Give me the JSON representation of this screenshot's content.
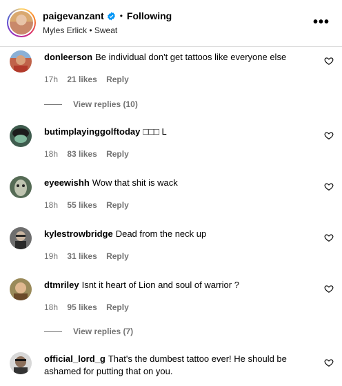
{
  "header": {
    "username": "paigevanzant",
    "separator": "•",
    "following": "Following",
    "audio": "Myles Erlick • Sweat",
    "more": "•••"
  },
  "comments": [
    {
      "user": "donleerson",
      "text": "Be individual don't get tattoos like everyone else",
      "time": "17h",
      "likes": "21 likes",
      "reply": "Reply"
    },
    {
      "user": "butimplayinggolftoday",
      "text": "□□□ L",
      "time": "18h",
      "likes": "83 likes",
      "reply": "Reply"
    },
    {
      "user": "eyeewishh",
      "text": "Wow that shit is wack",
      "time": "18h",
      "likes": "55 likes",
      "reply": "Reply"
    },
    {
      "user": "kylestrowbridge",
      "text": "Dead from the neck up",
      "time": "19h",
      "likes": "31 likes",
      "reply": "Reply"
    },
    {
      "user": "dtmriley",
      "text": "Isnt it heart of Lion and soul of warrior ?",
      "time": "18h",
      "likes": "95 likes",
      "reply": "Reply"
    },
    {
      "user": "official_lord_g",
      "text": "That's the dumbest tattoo ever! He should be ashamed for putting that on you."
    }
  ],
  "view_replies": [
    {
      "label": "View replies (10)"
    },
    {
      "label": "View replies (7)"
    }
  ],
  "colors": {
    "meta": "#737373",
    "border": "#dbdbdb",
    "verified": "#0095f6"
  },
  "icons": {
    "verified": "verified-badge-icon",
    "heart": "heart-outline-icon",
    "more": "more-options-icon"
  }
}
